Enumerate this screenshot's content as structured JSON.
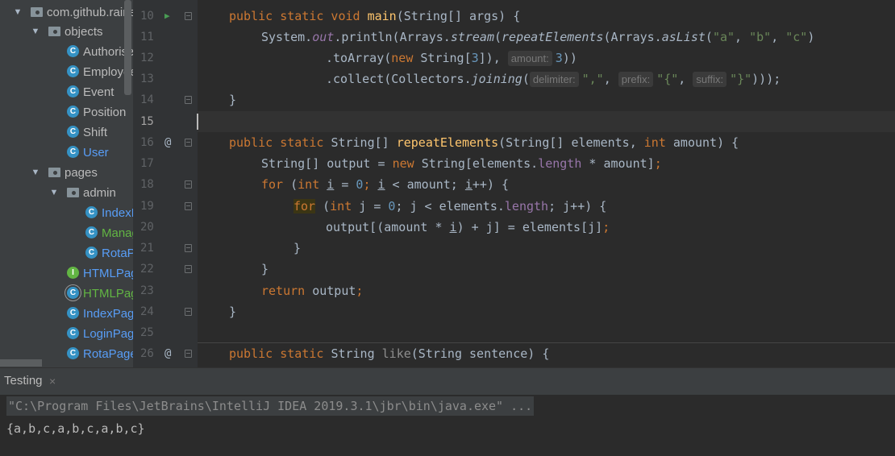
{
  "tree": {
    "root_label": "com.github.raine",
    "objects_label": "objects",
    "objects_items": [
      "Authorise",
      "Employee",
      "Event",
      "Position",
      "Shift",
      "User"
    ],
    "pages_label": "pages",
    "admin_label": "admin",
    "admin_items": [
      "IndexP",
      "Manag",
      "RotaP"
    ],
    "pages_items": [
      "HTMLPag",
      "HTMLPag",
      "IndexPag",
      "LoginPag",
      "RotaPage"
    ]
  },
  "editor": {
    "line_numbers": [
      "10",
      "11",
      "12",
      "13",
      "14",
      "15",
      "16",
      "17",
      "18",
      "19",
      "20",
      "21",
      "22",
      "23",
      "24",
      "25",
      "26"
    ],
    "gutter_at": "@",
    "hints": {
      "amount": "amount:",
      "delimiter": "delimiter:",
      "prefix": "prefix:",
      "suffix": "suffix:"
    },
    "code": {
      "l10": [
        "public static void ",
        "main",
        "(String[] args) {"
      ],
      "l11": [
        "System.",
        "out",
        ".println(Arrays.",
        "stream",
        "(",
        "repeatElements",
        "(Arrays.",
        "asList",
        "(",
        "\"a\"",
        ", ",
        "\"b\"",
        ", ",
        "\"c\"",
        ")"
      ],
      "l12": [
        ".toArray(",
        "new ",
        "String[",
        "3",
        "]), ",
        "3",
        "))"
      ],
      "l13": [
        ".collect(Collectors.",
        "joining",
        "(",
        "\",\"",
        ", ",
        "\"{\"",
        ", ",
        "\"}\"",
        ")));"
      ],
      "l14": "}",
      "l16": [
        "public static ",
        "String[] ",
        "repeatElements",
        "(String[] elements, ",
        "int ",
        "amount) {"
      ],
      "l17": [
        "String[] output = ",
        "new ",
        "String[elements.",
        "length",
        " * amount]",
        ";"
      ],
      "l18": [
        "for ",
        "(",
        "int ",
        "i",
        " = ",
        "0",
        "; ",
        "i",
        " < amount; ",
        "i",
        "++) {"
      ],
      "l19": [
        "for",
        " (",
        "int ",
        "j = ",
        "0",
        "; j < elements.",
        "length",
        "; j++) {"
      ],
      "l20": [
        "output[(amount * ",
        "i",
        ") + j] = elements[j]",
        ";"
      ],
      "l21": "}",
      "l22": "}",
      "l23": [
        "return ",
        "output",
        ";"
      ],
      "l24": "}",
      "l26": [
        "public static ",
        "String ",
        "like",
        "(String sentence) {"
      ]
    }
  },
  "bottom": {
    "tab_label": "Testing",
    "close_icon": "×",
    "command": "\"C:\\Program Files\\JetBrains\\IntelliJ IDEA 2019.3.1\\jbr\\bin\\java.exe\" ...",
    "output": "{a,b,c,a,b,c,a,b,c}"
  }
}
